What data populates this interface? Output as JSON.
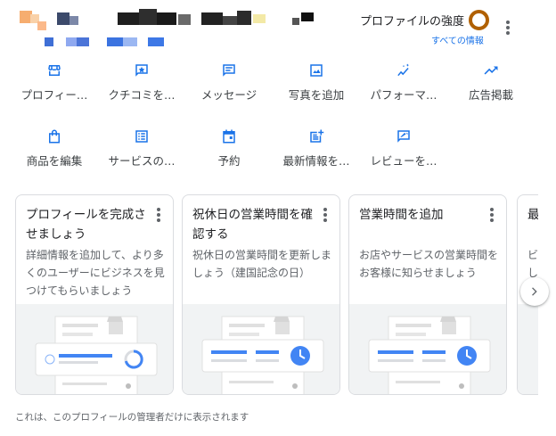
{
  "header": {
    "profile_strength_label": "プロファイルの強度",
    "all_info_link": "すべての情報",
    "accent_color": "#b06000",
    "link_color": "#1a73e8"
  },
  "actions": [
    {
      "label": "プロフィー…",
      "icon": "storefront-icon"
    },
    {
      "label": "クチコミを…",
      "icon": "star-review-icon"
    },
    {
      "label": "メッセージ",
      "icon": "message-icon"
    },
    {
      "label": "写真を追加",
      "icon": "photo-icon"
    },
    {
      "label": "パフォーマ…",
      "icon": "performance-icon"
    },
    {
      "label": "広告掲載",
      "icon": "trending-up-icon"
    },
    {
      "label": "商品を編集",
      "icon": "shopping-bag-icon"
    },
    {
      "label": "サービスの…",
      "icon": "list-icon"
    },
    {
      "label": "予約",
      "icon": "calendar-icon"
    },
    {
      "label": "最新情報を…",
      "icon": "post-add-icon"
    },
    {
      "label": "レビューを…",
      "icon": "rate-review-icon"
    }
  ],
  "cards": [
    {
      "title": "プロフィールを完成させましょう",
      "description": "詳細情報を追加して、より多くのユーザーにビジネスを見つけてもらいましょう"
    },
    {
      "title": "祝休日の営業時間を確認する",
      "description": "祝休日の営業時間を更新しましょう（建国記念の日）"
    },
    {
      "title": "営業時間を追加",
      "description": "お店やサービスの営業時間をお客様に知らせましょう"
    }
  ],
  "partial_card": {
    "title": "最",
    "description": "ビ し"
  },
  "footer_note": "これは、このプロフィールの管理者だけに表示されます"
}
